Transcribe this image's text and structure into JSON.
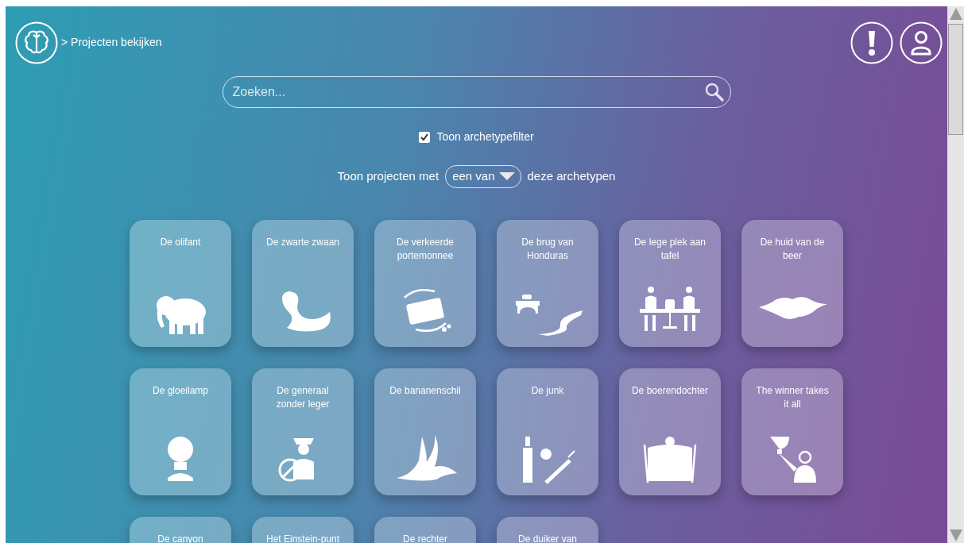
{
  "breadcrumb": "> Projecten bekijken",
  "search": {
    "placeholder": "Zoeken..."
  },
  "archetype_filter": {
    "label": "Toon archetypefilter",
    "checked": true
  },
  "filter_sentence": {
    "before": "Toon projecten met",
    "mode": "een van",
    "after": "deze archetypen"
  },
  "cards": [
    {
      "title": "De olifant"
    },
    {
      "title": "De zwarte zwaan"
    },
    {
      "title": "De verkeerde portemonnee"
    },
    {
      "title": "De brug van Honduras"
    },
    {
      "title": "De lege plek aan tafel"
    },
    {
      "title": "De huid van de beer"
    },
    {
      "title": "De gloeilamp"
    },
    {
      "title": "De generaal zonder leger"
    },
    {
      "title": "De bananenschil"
    },
    {
      "title": "De junk"
    },
    {
      "title": "De boerendochter"
    },
    {
      "title": "The winner takes it all"
    },
    {
      "title": "De canyon"
    },
    {
      "title": "Het Einstein-punt"
    },
    {
      "title": "De rechter"
    },
    {
      "title": "De duiker van"
    }
  ]
}
